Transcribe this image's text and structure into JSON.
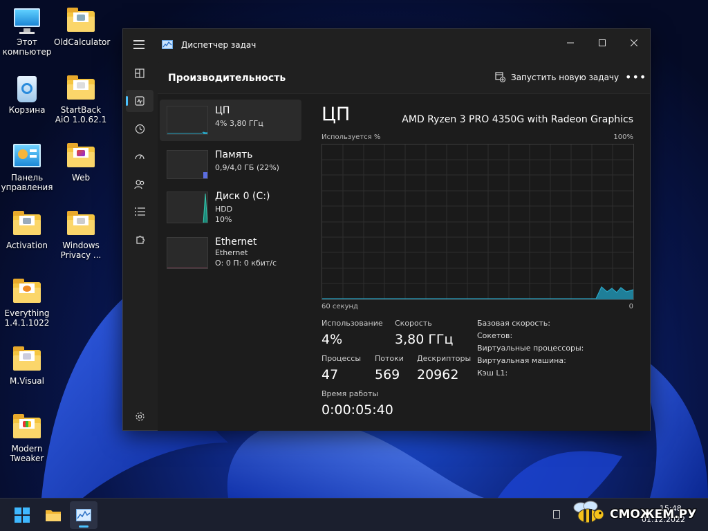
{
  "desktop": {
    "icons": [
      {
        "label": "Этот компьютер",
        "icon": "computer-icon"
      },
      {
        "label": "Корзина",
        "icon": "recycle-bin-icon"
      },
      {
        "label": "Панель управления",
        "icon": "control-panel-icon"
      },
      {
        "label": "Activation",
        "icon": "folder-icon"
      },
      {
        "label": "Everything 1.4.1.1022",
        "icon": "everything-icon"
      },
      {
        "label": "M.Visual",
        "icon": "folder-icon"
      },
      {
        "label": "Modern Tweaker",
        "icon": "folder-icon"
      },
      {
        "label": "OldCalculator",
        "icon": "folder-icon"
      },
      {
        "label": "StartBack AiO 1.0.62.1",
        "icon": "folder-icon"
      },
      {
        "label": "Web",
        "icon": "folder-icon"
      },
      {
        "label": "Windows Privacy ...",
        "icon": "folder-icon"
      }
    ]
  },
  "window": {
    "title": "Диспетчер задач",
    "page_title": "Производительность",
    "new_task_label": "Запустить новую задачу",
    "more_label": "•••",
    "nav": [
      "processes",
      "performance",
      "app-history",
      "startup",
      "users",
      "details",
      "services",
      "settings"
    ],
    "active_nav": "performance"
  },
  "resources": [
    {
      "name": "ЦП",
      "sub1": "4% 3,80 ГГц",
      "sub2": "",
      "selected": true
    },
    {
      "name": "Память",
      "sub1": "0,9/4,0 ГБ (22%)",
      "sub2": "",
      "selected": false
    },
    {
      "name": "Диск 0 (C:)",
      "sub1": "HDD",
      "sub2": "10%",
      "selected": false
    },
    {
      "name": "Ethernet",
      "sub1": "Ethernet",
      "sub2": "О: 0 П: 0 кбит/с",
      "selected": false
    }
  ],
  "cpu": {
    "title": "ЦП",
    "model": "AMD Ryzen 3 PRO 4350G with Radeon Graphics",
    "graph_label_top_left": "Используется %",
    "graph_label_top_right": "100%",
    "graph_label_bottom_left": "60 секунд",
    "graph_label_bottom_right": "0",
    "usage_label": "Использование",
    "usage_value": "4%",
    "speed_label": "Скорость",
    "speed_value": "3,80 ГГц",
    "processes_label": "Процессы",
    "processes_value": "47",
    "threads_label": "Потоки",
    "threads_value": "569",
    "handles_label": "Дескрипторы",
    "handles_value": "20962",
    "uptime_label": "Время работы",
    "uptime_value": "0:00:05:40",
    "specs": [
      "Базовая скорость:",
      "Сокетов:",
      "Виртуальные процессоры:",
      "Виртуальная машина:",
      "Кэш L1:"
    ],
    "accent_color": "#2aa5c4"
  },
  "taskbar": {
    "time": "15:48",
    "date": "01.12.2022",
    "watermark": "СМОЖЕМ.РУ"
  }
}
